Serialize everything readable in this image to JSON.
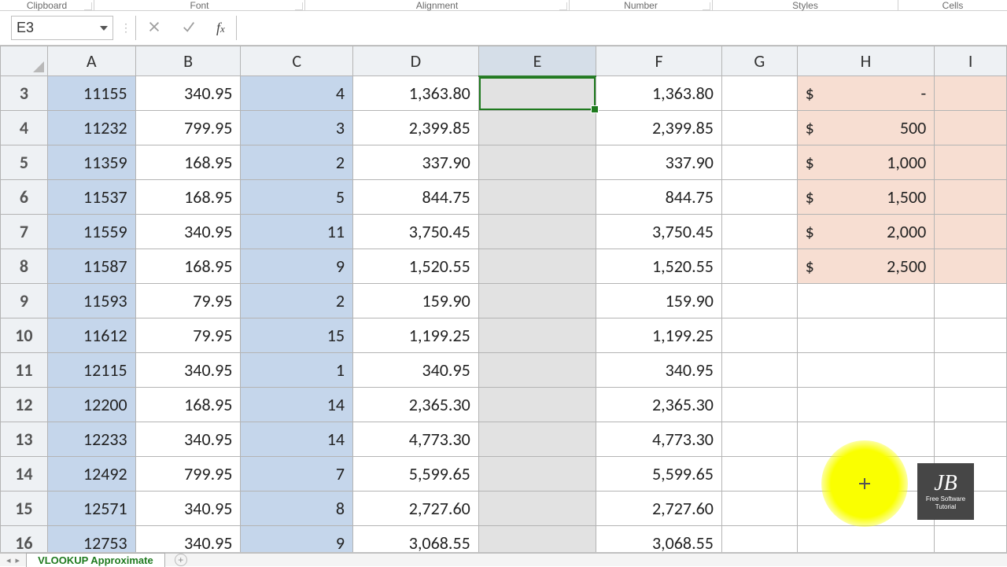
{
  "ribbon": {
    "groups": [
      "Clipboard",
      "Font",
      "Alignment",
      "Number",
      "Styles",
      "Cells"
    ]
  },
  "formula_bar": {
    "name_box": "E3",
    "formula": ""
  },
  "columns": [
    "A",
    "B",
    "C",
    "D",
    "E",
    "F",
    "G",
    "H",
    "I"
  ],
  "selected_column": "E",
  "selected_cell": "E3",
  "row_start": 3,
  "rows": [
    {
      "n": 3,
      "A": "11155",
      "B": "340.95",
      "C": "4",
      "D": "1,363.80",
      "F": "1,363.80",
      "H": "-"
    },
    {
      "n": 4,
      "A": "11232",
      "B": "799.95",
      "C": "3",
      "D": "2,399.85",
      "F": "2,399.85",
      "H": "500"
    },
    {
      "n": 5,
      "A": "11359",
      "B": "168.95",
      "C": "2",
      "D": "337.90",
      "F": "337.90",
      "H": "1,000"
    },
    {
      "n": 6,
      "A": "11537",
      "B": "168.95",
      "C": "5",
      "D": "844.75",
      "F": "844.75",
      "H": "1,500"
    },
    {
      "n": 7,
      "A": "11559",
      "B": "340.95",
      "C": "11",
      "D": "3,750.45",
      "F": "3,750.45",
      "H": "2,000"
    },
    {
      "n": 8,
      "A": "11587",
      "B": "168.95",
      "C": "9",
      "D": "1,520.55",
      "F": "1,520.55",
      "H": "2,500"
    },
    {
      "n": 9,
      "A": "11593",
      "B": "79.95",
      "C": "2",
      "D": "159.90",
      "F": "159.90"
    },
    {
      "n": 10,
      "A": "11612",
      "B": "79.95",
      "C": "15",
      "D": "1,199.25",
      "F": "1,199.25"
    },
    {
      "n": 11,
      "A": "12115",
      "B": "340.95",
      "C": "1",
      "D": "340.95",
      "F": "340.95"
    },
    {
      "n": 12,
      "A": "12200",
      "B": "168.95",
      "C": "14",
      "D": "2,365.30",
      "F": "2,365.30"
    },
    {
      "n": 13,
      "A": "12233",
      "B": "340.95",
      "C": "14",
      "D": "4,773.30",
      "F": "4,773.30"
    },
    {
      "n": 14,
      "A": "12492",
      "B": "799.95",
      "C": "7",
      "D": "5,599.65",
      "F": "5,599.65"
    },
    {
      "n": 15,
      "A": "12571",
      "B": "340.95",
      "C": "8",
      "D": "2,727.60",
      "F": "2,727.60"
    },
    {
      "n": 16,
      "A": "12753",
      "B": "340.95",
      "C": "9",
      "D": "3,068.55",
      "F": "3,068.55"
    }
  ],
  "currency_symbol": "$",
  "sheet_tab": "VLOOKUP Approximate",
  "logo": {
    "top": "JB",
    "line1": "Free Software",
    "line2": "Tutorial"
  }
}
